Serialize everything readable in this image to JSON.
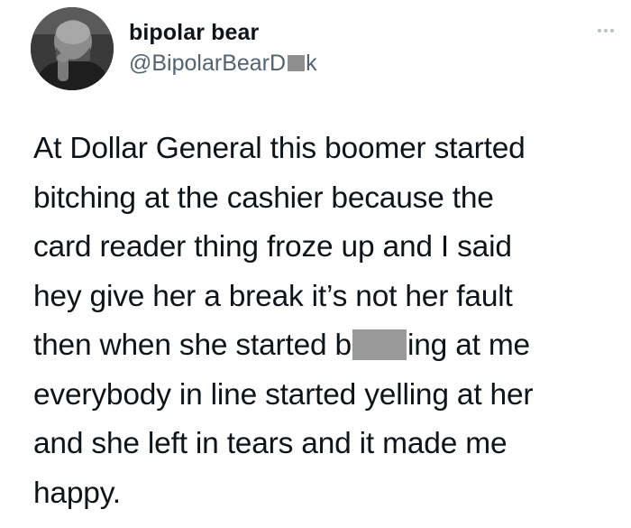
{
  "tweet": {
    "author": {
      "display_name": "bipolar bear",
      "handle_prefix": "@BipolarBearD",
      "handle_suffix": "k",
      "avatar_icon": "profile-photo"
    },
    "more_icon": "more-horizontal-icon",
    "body": {
      "lines": [
        "At Dollar General this boomer started",
        "bitching at the cashier because the",
        "card reader thing froze up and I said",
        "hey give her a break it’s not her fault",
        "then when she started b",
        "ing at me",
        "everybody in line started yelling at her",
        "and she left in tears and it made me",
        "happy."
      ]
    }
  },
  "colors": {
    "text": "#0f1419",
    "secondary_text": "#536471",
    "redaction": "#9a9a9a",
    "more_dots": "#b8c2cc"
  }
}
